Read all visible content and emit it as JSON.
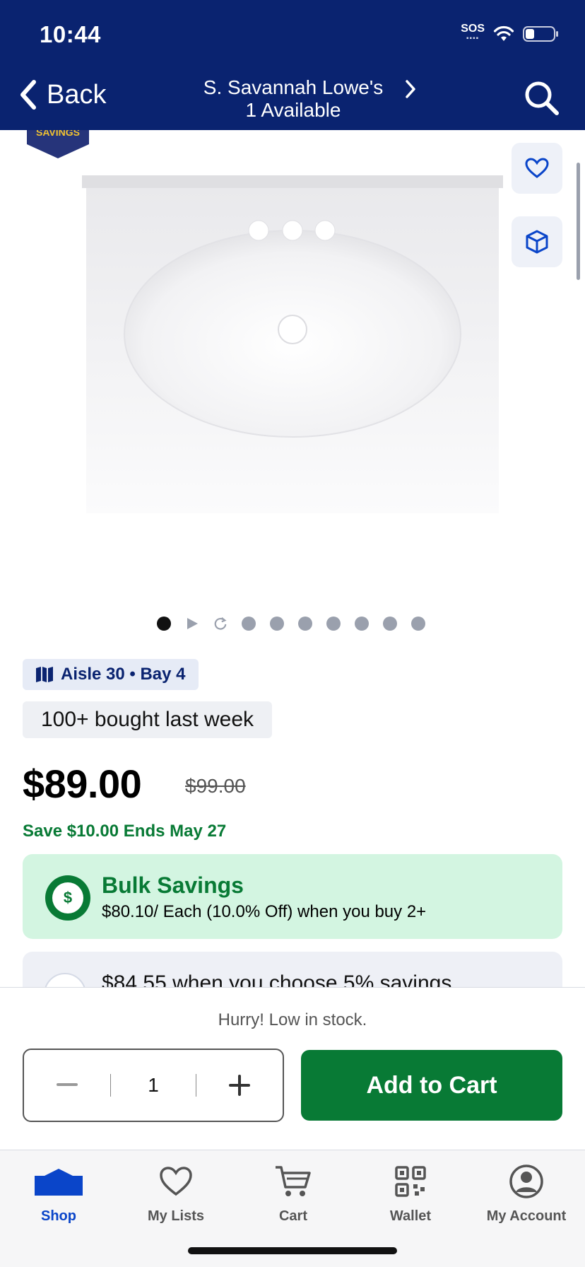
{
  "status_bar": {
    "time": "10:44",
    "sos": "SOS"
  },
  "header": {
    "back_label": "Back",
    "store_name": "S. Savannah Lowe's",
    "availability": "1 Available"
  },
  "badge_text": "SAVINGS",
  "gallery": {
    "total_dots": 10,
    "active_index": 0
  },
  "location": {
    "aisle": "Aisle 30 • Bay 4"
  },
  "social_proof": "100+ bought last week",
  "pricing": {
    "price": "$89.00",
    "was_price": "$99.00",
    "savings": "Save $10.00 Ends May 27"
  },
  "bulk": {
    "title": "Bulk Savings",
    "subtitle": "$80.10/ Each (10.0% Off) when you buy 2+"
  },
  "card_offer": "$84.55 when you choose 5% savings",
  "stock_message": "Hurry! Low in stock.",
  "quantity": {
    "value": "1"
  },
  "add_to_cart_label": "Add to Cart",
  "tabs": [
    {
      "label": "Shop"
    },
    {
      "label": "My Lists"
    },
    {
      "label": "Cart"
    },
    {
      "label": "Wallet"
    },
    {
      "label": "My Account"
    }
  ],
  "colors": {
    "brand_navy": "#0a2370",
    "accent_green": "#087a35",
    "bulk_bg": "#d3f5e1",
    "tab_active": "#0a45c9"
  }
}
